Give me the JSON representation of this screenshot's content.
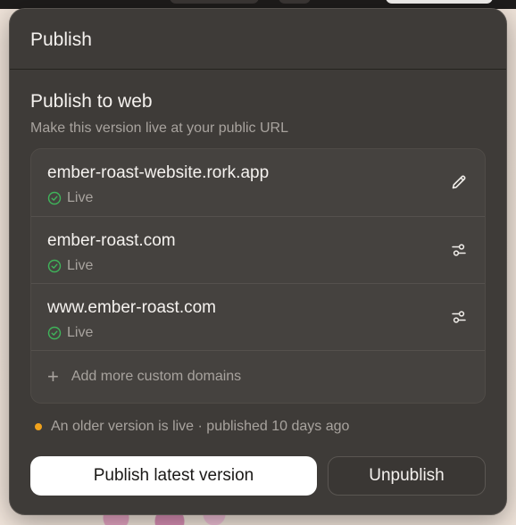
{
  "header": {
    "title": "Publish"
  },
  "publish_section": {
    "title": "Publish to web",
    "subtitle": "Make this version live at your public URL"
  },
  "domains": [
    {
      "name": "ember-roast-website.rork.app",
      "status": "Live",
      "action_icon": "pencil-icon"
    },
    {
      "name": "ember-roast.com",
      "status": "Live",
      "action_icon": "settings-sliders-icon"
    },
    {
      "name": "www.ember-roast.com",
      "status": "Live",
      "action_icon": "settings-sliders-icon"
    }
  ],
  "add_domain": {
    "label": "Add more custom domains",
    "icon": "plus-icon"
  },
  "status": {
    "text": "An older version is live · published 10 days ago",
    "dot_color": "#f0a21c"
  },
  "buttons": {
    "publish": "Publish latest version",
    "unpublish": "Unpublish"
  },
  "colors": {
    "live_green": "#3fb45a",
    "panel_bg": "#3e3b38"
  }
}
